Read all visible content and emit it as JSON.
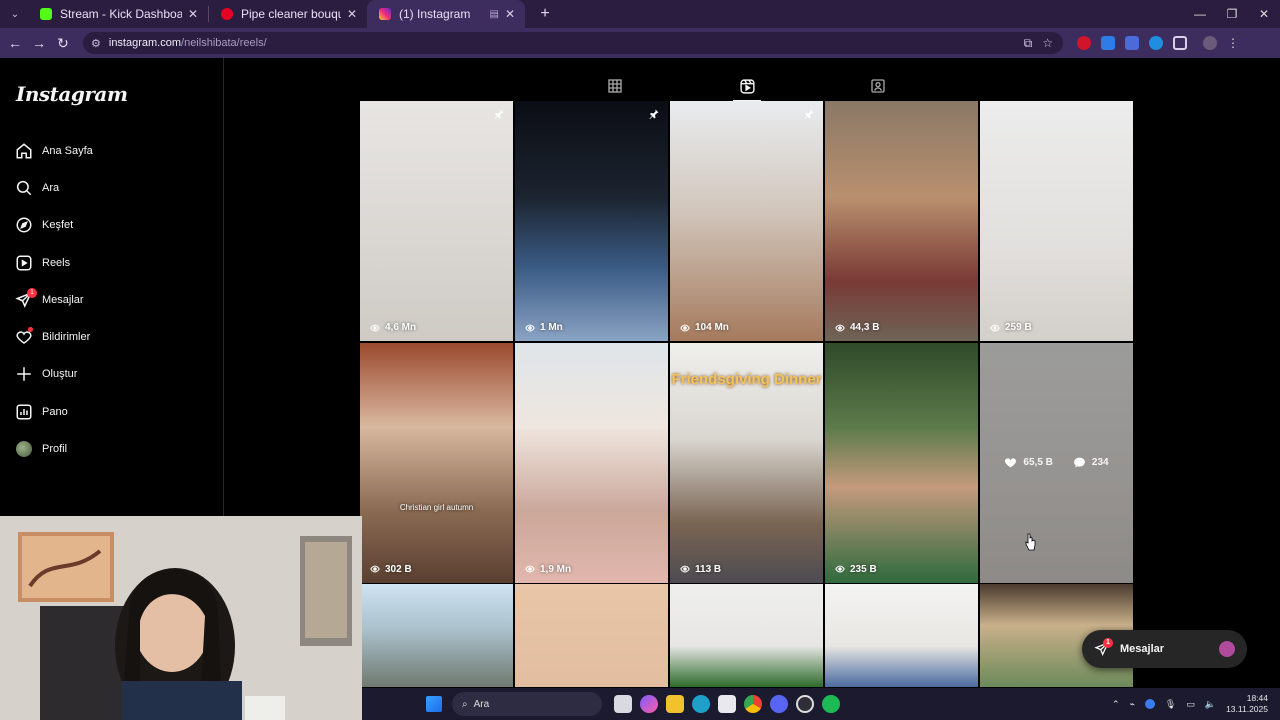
{
  "browser": {
    "tabs": [
      {
        "title": "Stream - Kick Dashboard",
        "favicon_color": "#53fc18",
        "active": false
      },
      {
        "title": "Pipe cleaner bouquet",
        "favicon_color": "#e60023",
        "active": false
      },
      {
        "title": "(1) Instagram",
        "favicon_color": "#d6249f",
        "active": true
      }
    ],
    "url_host": "instagram.com",
    "url_path": "/neilshibata/reels/"
  },
  "instagram": {
    "logo": "Instagram",
    "nav": [
      {
        "label": "Ana Sayfa",
        "icon": "home-icon"
      },
      {
        "label": "Ara",
        "icon": "search-icon"
      },
      {
        "label": "Keşfet",
        "icon": "compass-icon"
      },
      {
        "label": "Reels",
        "icon": "reels-icon"
      },
      {
        "label": "Mesajlar",
        "icon": "messenger-icon",
        "badge": "1"
      },
      {
        "label": "Bildirimler",
        "icon": "heart-icon",
        "dot": true
      },
      {
        "label": "Oluştur",
        "icon": "plus-icon"
      },
      {
        "label": "Pano",
        "icon": "dashboard-icon"
      },
      {
        "label": "Profil",
        "icon": "avatar"
      }
    ],
    "reels": [
      {
        "views": "4,6 Mn",
        "pinned": true,
        "bg": "linear-gradient(180deg,#e8e6e3 0%,#d9d6d2 60%,#cfcac4 100%)"
      },
      {
        "views": "1 Mn",
        "pinned": true,
        "bg": "linear-gradient(180deg,#0b0d14 0%,#1c2430 40%,#3b5c86 70%,#8aa3c4 100%)"
      },
      {
        "views": "104 Mn",
        "pinned": true,
        "bg": "linear-gradient(180deg,#e9ecef 0%,#d2c7bd 45%,#a57a5d 100%)"
      },
      {
        "views": "44,3 B",
        "pinned": false,
        "bg": "linear-gradient(180deg,#8a7866 0%,#b9906f 40%,#7a3a35 75%,#6e6457 100%)"
      },
      {
        "views": "259 B",
        "pinned": false,
        "bg": "linear-gradient(180deg,#ececec 0%,#e2e0dd 60%,#d3cfca 100%)"
      },
      {
        "views": "302 B",
        "pinned": false,
        "caption": "Christian girl autumn",
        "bg": "linear-gradient(180deg,#9b4a2e 0%,#d9b8a0 35%,#8a6a52 70%,#5a3f31 100%)"
      },
      {
        "views": "1,9 Mn",
        "pinned": false,
        "bg": "linear-gradient(180deg,#dfe5ea 0%,#efe6df 35%,#caa79a 70%,#e2b7ad 100%)"
      },
      {
        "views": "113 B",
        "pinned": false,
        "headline": "Friendsgiving Dinner",
        "bg": "linear-gradient(180deg,#efefec 0%,#d9d6d0 40%,#7a6553 75%,#4d4b52 100%)"
      },
      {
        "views": "235 B",
        "pinned": false,
        "bg": "linear-gradient(180deg,#2e4a2a 0%,#5c7a4a 35%,#c49a7d 60%,#2f6a3d 100%)"
      },
      {
        "views": "",
        "pinned": false,
        "hover": true,
        "likes": "65,5 B",
        "comments": "234",
        "bg": "linear-gradient(180deg,#f0f0ee 0%,#e6e2de 60%,#d9d5d0 100%)"
      },
      {
        "views": "",
        "pinned": false,
        "bg": "linear-gradient(180deg,#cfe3f3 0%,#a9bfca 45%,#6f7a70 100%)"
      },
      {
        "views": "",
        "pinned": false,
        "bg": "linear-gradient(180deg,#e8c6a8 0%,#e3bda0 100%)"
      },
      {
        "views": "",
        "pinned": false,
        "bg": "linear-gradient(180deg,#efefee 0%,#e7e6e4 60%,#2d6a2b 100%)"
      },
      {
        "views": "",
        "pinned": false,
        "bg": "linear-gradient(180deg,#f4f4f2 0%,#e8e6e2 60%,#4a6aa0 100%)"
      },
      {
        "views": "",
        "pinned": false,
        "bg": "linear-gradient(180deg,#4a3a2e 0%,#c9b08a 40%,#6c8a5a 100%)"
      }
    ],
    "messages_pill": {
      "label": "Mesajlar",
      "badge": "1"
    }
  },
  "taskbar": {
    "search_label": "Ara",
    "time": "18:44",
    "date": "13.11.2025"
  },
  "colors": {
    "browser_tabbar": "#2b1d3f",
    "browser_toolbar": "#3d2c5e",
    "ig_bg": "#000000",
    "badge_red": "#ff3040"
  }
}
